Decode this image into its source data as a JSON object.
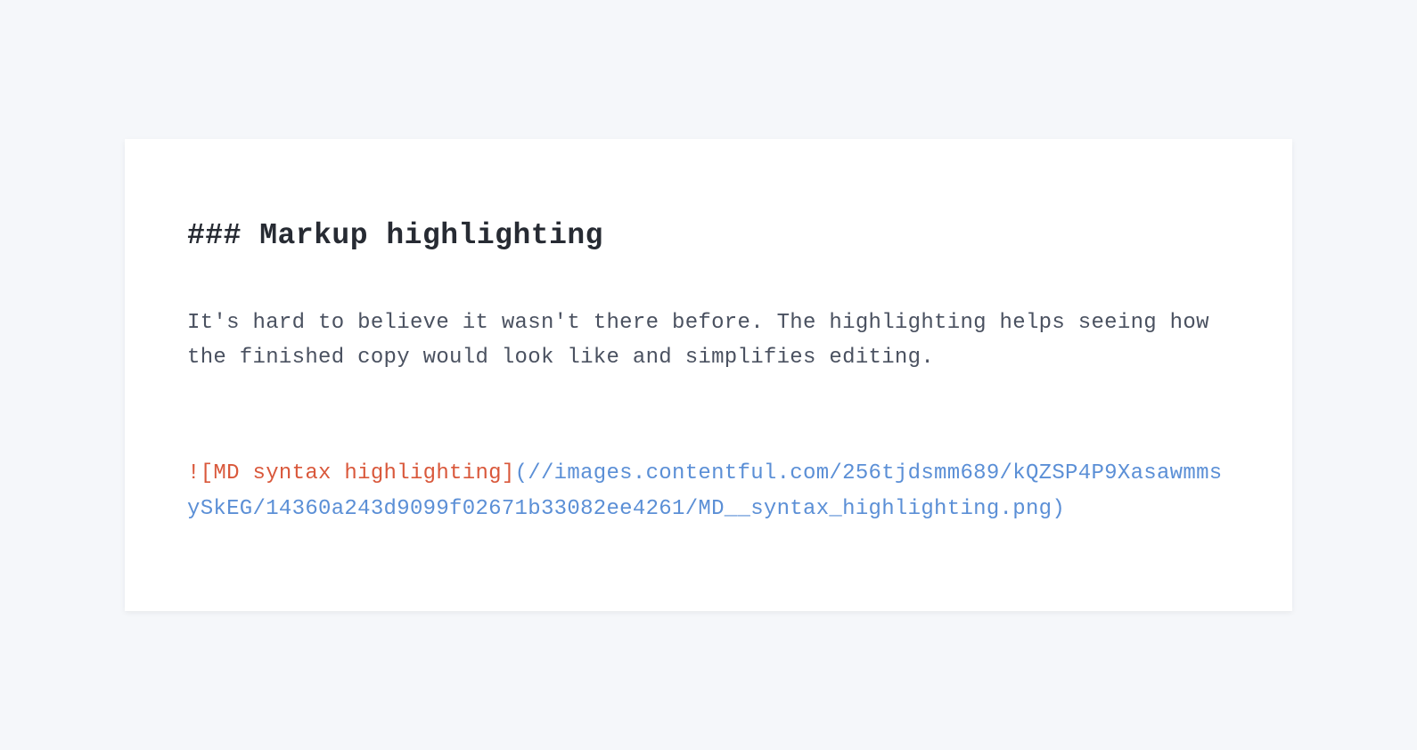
{
  "heading": "### Markup highlighting",
  "paragraph": "It's hard to believe it wasn't there before. The highlighting helps seeing how the finished copy would look like and simplifies editing.",
  "imageAlt": "![MD  syntax highlighting]",
  "imageUrl": "(//images.contentful.com/256tjdsmm689/kQZSP4P9XasawmmsySkEG/14360a243d9099f02671b33082ee4261/MD__syntax_highlighting.png)"
}
